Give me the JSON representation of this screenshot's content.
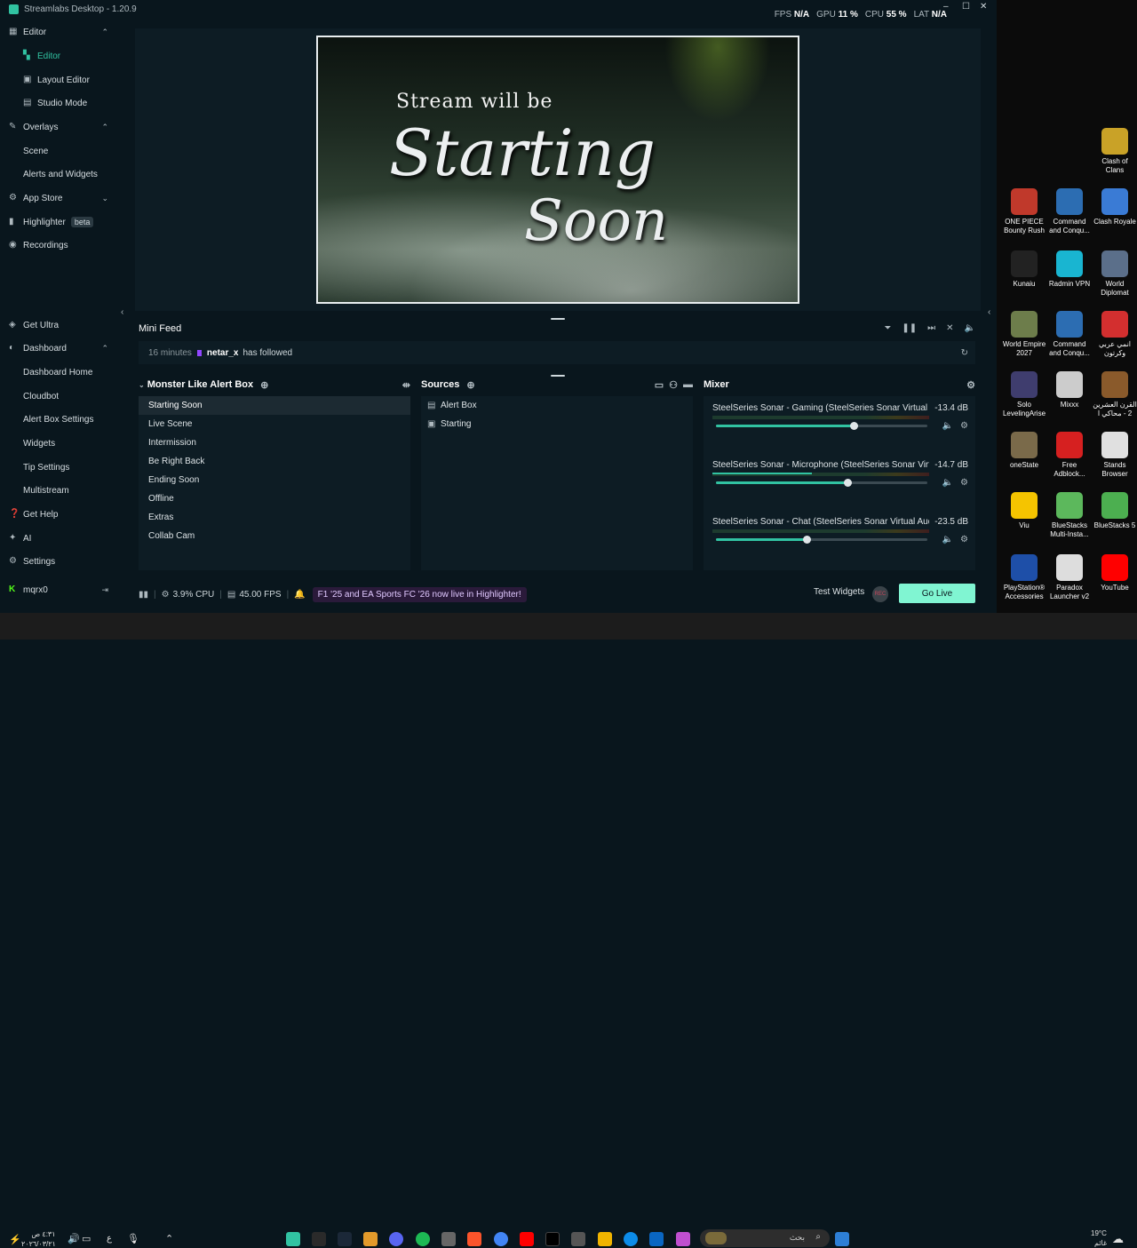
{
  "window": {
    "title": "Streamlabs Desktop - 1.20.9",
    "stats": {
      "fps_label": "FPS",
      "fps_value": "N/A",
      "gpu_label": "GPU",
      "gpu_value": "11 %",
      "cpu_label": "CPU",
      "cpu_value": "55 %",
      "lat_label": "LAT",
      "lat_value": "N/A"
    },
    "controls": {
      "minimize": "–",
      "maximize": "☐",
      "close": "✕"
    }
  },
  "sidebar": {
    "editor_group": "Editor",
    "editor": "Editor",
    "layout_editor": "Layout Editor",
    "studio_mode": "Studio Mode",
    "overlays_group": "Overlays",
    "scene": "Scene",
    "alerts_widgets": "Alerts and Widgets",
    "app_store": "App Store",
    "highlighter": "Highlighter",
    "highlighter_badge": "beta",
    "recordings": "Recordings",
    "get_ultra": "Get Ultra",
    "dashboard_group": "Dashboard",
    "dashboard_home": "Dashboard Home",
    "cloudbot": "Cloudbot",
    "alert_box_settings": "Alert Box Settings",
    "widgets": "Widgets",
    "tip_settings": "Tip Settings",
    "multistream": "Multistream",
    "get_help": "Get Help",
    "ai": "AI",
    "settings": "Settings",
    "user": "mqrx0"
  },
  "preview": {
    "line1": "Stream will be",
    "line2": "Starting",
    "line3": "Soon"
  },
  "minifeed": {
    "title": "Mini Feed",
    "event": {
      "time": "16 minutes",
      "user": "netar_x",
      "action": "has followed"
    }
  },
  "scenes": {
    "title": "Monster Like Alert Box",
    "items": [
      "Starting Soon",
      "Live Scene",
      "Intermission",
      "Be Right Back",
      "Ending Soon",
      "Offline",
      "Extras",
      "Collab Cam"
    ],
    "selected": 0
  },
  "sources": {
    "title": "Sources",
    "items": [
      {
        "name": "Alert Box",
        "icon": "alert-box-icon"
      },
      {
        "name": "Starting",
        "icon": "image-icon"
      }
    ]
  },
  "mixer": {
    "title": "Mixer",
    "channels": [
      {
        "name": "SteelSeries Sonar - Gaming (SteelSeries Sonar Virtual Au...",
        "db": "-13.4 dB",
        "volume": 0.65,
        "level": 0.0
      },
      {
        "name": "SteelSeries Sonar - Microphone (SteelSeries Sonar Virtu...",
        "db": "-14.7 dB",
        "volume": 0.62,
        "level": 0.46
      },
      {
        "name": "SteelSeries Sonar - Chat (SteelSeries Sonar Virtual Audio...",
        "db": "-23.5 dB",
        "volume": 0.43,
        "level": 0.0
      }
    ]
  },
  "footer": {
    "cpu": "3.9% CPU",
    "fps": "45.00 FPS",
    "highlight": "F1 '25 and EA Sports FC '26 now live in Highlighter!",
    "test_widgets": "Test Widgets",
    "rec": "REC",
    "go_live": "Go Live"
  },
  "desktop_icons": [
    {
      "label": "Clash of Clans",
      "color": "#c9a227"
    },
    {
      "label": "ONE PIECE Bounty Rush",
      "color": "#c0392b"
    },
    {
      "label": "Command and Conqu...",
      "color": "#2c6db2"
    },
    {
      "label": "Clash Royale",
      "color": "#3a7bd5"
    },
    {
      "label": "Kunaiu",
      "color": "#222222"
    },
    {
      "label": "Radmin VPN",
      "color": "#19b5d1"
    },
    {
      "label": "World Diplomat",
      "color": "#5b6f8a"
    },
    {
      "label": "World Empire 2027",
      "color": "#6d7d4b"
    },
    {
      "label": "Command and Conqu...",
      "color": "#2c6db2"
    },
    {
      "label": "انمي عربي وكرتون",
      "color": "#d32f2f"
    },
    {
      "label": "Solo LevelingArise",
      "color": "#3f3d6e"
    },
    {
      "label": "Mixxx",
      "color": "#cccccc"
    },
    {
      "label": "القرن العشرين 2 - محاكي ا",
      "color": "#8a5a2b"
    },
    {
      "label": "oneState",
      "color": "#7a6a4a"
    },
    {
      "label": "Free Adblock...",
      "color": "#d62020"
    },
    {
      "label": "Stands Browser",
      "color": "#e0e0e0"
    },
    {
      "label": "Viu",
      "color": "#f5c400"
    },
    {
      "label": "BlueStacks Multi-Insta...",
      "color": "#5cb85c"
    },
    {
      "label": "BlueStacks 5",
      "color": "#4caf50"
    },
    {
      "label": "PlayStation® Accessories",
      "color": "#1e4fa8"
    },
    {
      "label": "Paradox Launcher v2",
      "color": "#dddddd"
    },
    {
      "label": "YouTube",
      "color": "#ff0000"
    }
  ],
  "taskbar": {
    "time": "٤:٣١ ص",
    "date": "٢٠٢٦/٠٣/٢١",
    "lang": "ع",
    "search_placeholder": "بحث",
    "weather_temp": "19°C",
    "weather_desc": "غائم"
  }
}
